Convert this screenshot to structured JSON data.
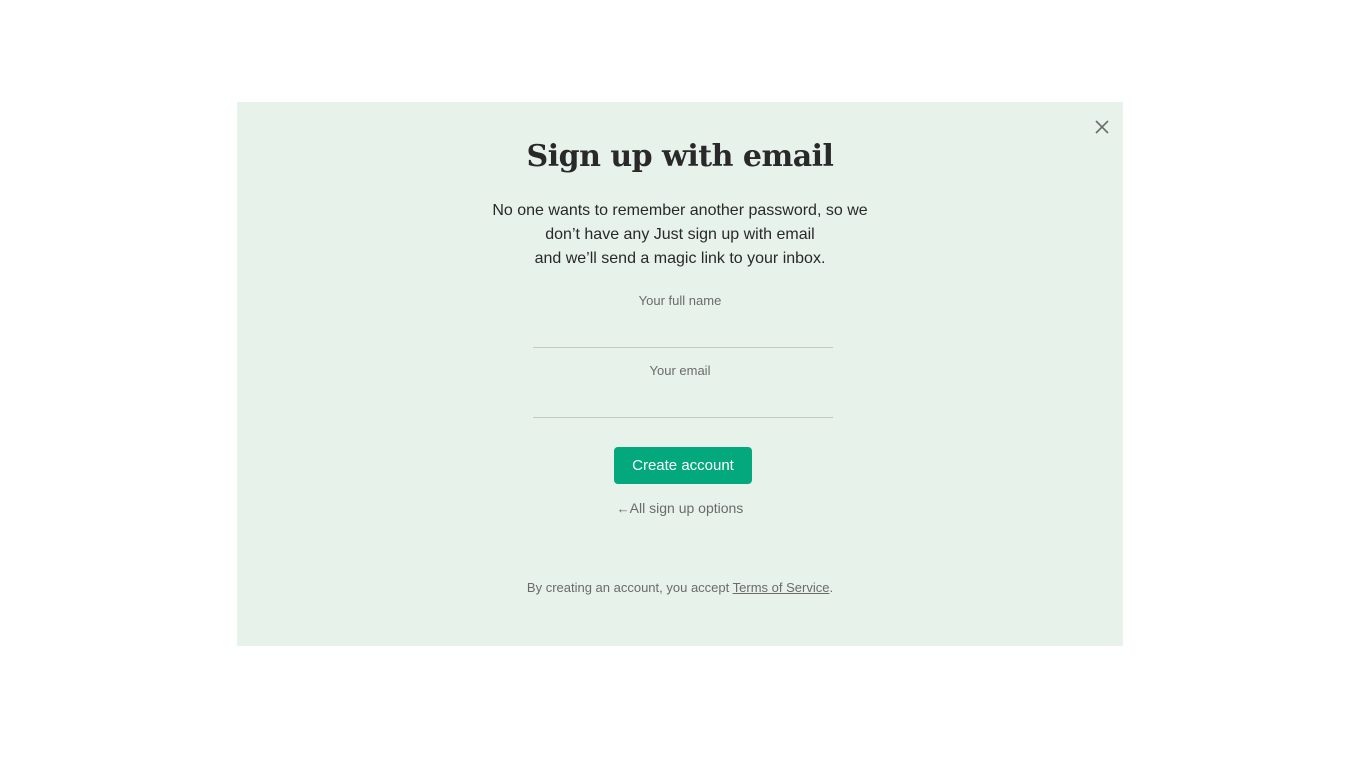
{
  "modal": {
    "close_icon": "close-icon",
    "title": "Sign up with email",
    "description_lines": [
      "No one wants to remember another password, so we",
      "don’t have any  Just sign up with email",
      "and we’ll send a magic link to your inbox."
    ],
    "fields": {
      "name_label": "Your full name",
      "name_value": "",
      "email_label": "Your email",
      "email_value": ""
    },
    "create_button_label": "Create account",
    "back_link": {
      "arrow": "←",
      "label": "All sign up options"
    },
    "terms": {
      "prefix": "By creating an account, you accept ",
      "link_text": "Terms of Service",
      "suffix": "."
    },
    "colors": {
      "background": "#e7f2ea",
      "accent": "#03a87c"
    }
  }
}
